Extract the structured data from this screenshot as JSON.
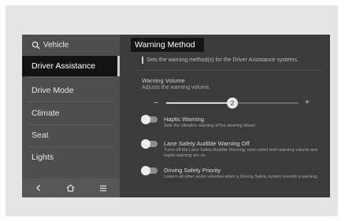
{
  "sidebar": {
    "search_label": "Vehicle",
    "items": [
      {
        "label": "Driver Assistance",
        "active": true
      },
      {
        "label": "Drive Mode",
        "active": false
      },
      {
        "label": "Climate",
        "active": false
      },
      {
        "label": "Seat",
        "active": false
      },
      {
        "label": "Lights",
        "active": false
      }
    ],
    "bottom_icons": [
      "back-icon",
      "home-icon",
      "menu-icon"
    ]
  },
  "main": {
    "title": "Warning Method",
    "description": "Sets the warning method(s) for the Driver Assistance systems.",
    "volume": {
      "title": "Warning Volume",
      "subtitle": "Adjusts the warning volume.",
      "value": "2",
      "fraction": 0.5
    },
    "options": [
      {
        "title": "Haptic Warning",
        "desc": "Sets the vibration warning of the steering wheel.",
        "on": false
      },
      {
        "title": "Lane Safety Audible Warning Off",
        "desc": "Turns off the Lane Safety Audible Warning, even when both warning volume and haptic warning are on.",
        "on": false
      },
      {
        "title": "Driving Safety Priority",
        "desc": "Lowers all other audio volumes when a Driving Safety system sounds a warning.",
        "on": false
      }
    ]
  },
  "colors": {
    "screen_bg": "#3b3b3b",
    "sidebar_bg": "#4e4e4e",
    "active_bg": "#131313"
  }
}
